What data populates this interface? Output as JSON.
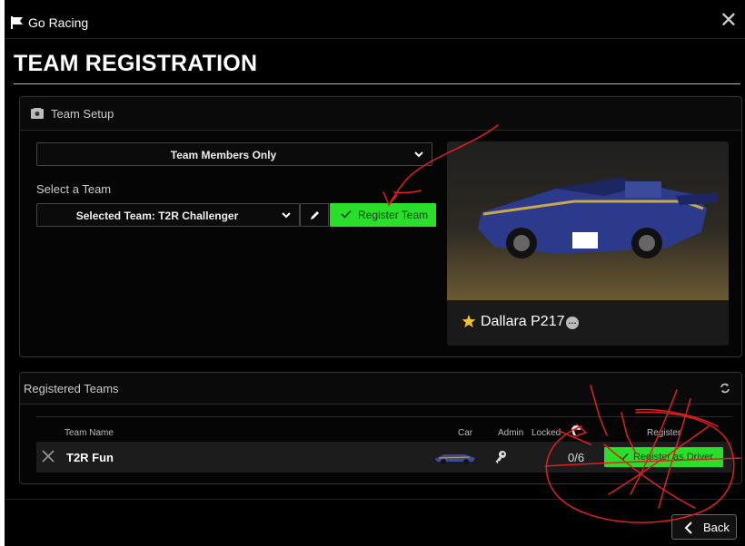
{
  "app": {
    "title": "Go Racing",
    "close_glyph": "✕"
  },
  "page": {
    "title": "TEAM REGISTRATION"
  },
  "setup": {
    "header": "Team Setup",
    "members_select": "Team Members Only",
    "select_label": "Select a Team",
    "team_select": "Selected Team: T2R Challenger",
    "register_team_label": "Register Team",
    "car_name": "Dallara P217",
    "info_glyph": "…"
  },
  "registered": {
    "header": "Registered Teams",
    "columns": {
      "team_name": "Team Name",
      "car": "Car",
      "admin": "Admin",
      "locked": "Locked",
      "register": "Register"
    },
    "rows": [
      {
        "name": "T2R Fun",
        "slots": "0/6",
        "register_label": "Register as Driver"
      }
    ]
  },
  "footer": {
    "back_label": "Back"
  },
  "colors": {
    "accent_green": "#2adf2a",
    "background": "#000000",
    "annotation_red": "#e02020"
  }
}
